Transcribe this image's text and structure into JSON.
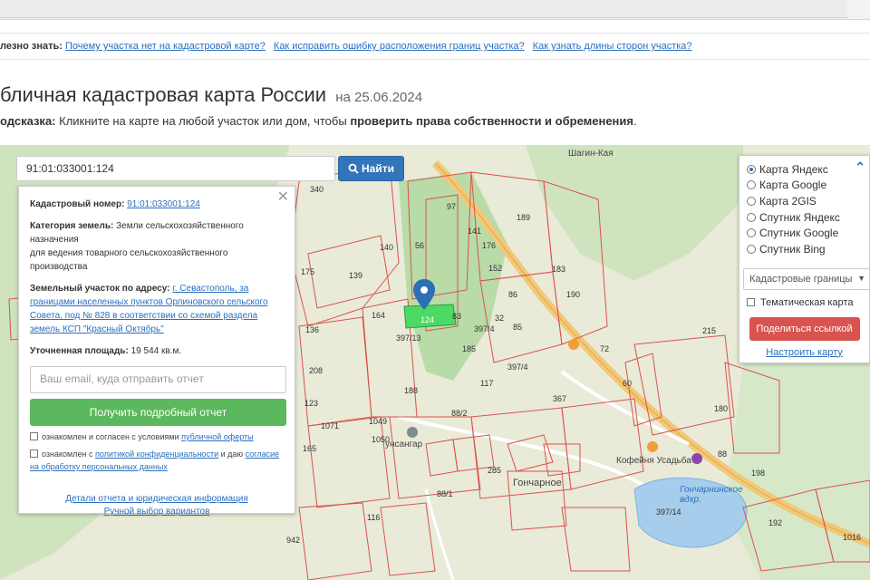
{
  "helpline": {
    "label": "лезно знать:",
    "links": [
      "Почему участка нет на кадастровой карте?",
      "Как исправить ошибку расположения границ участка?",
      "Как узнать длины сторон участка?"
    ]
  },
  "page": {
    "title": "бличная кадастровая карта России",
    "date": "на 25.06.2024",
    "hint_prefix": "одсказка:",
    "hint_text": "Кликните на карте на любой участок или дом, чтобы",
    "hint_bold": "проверить права собственности и обременения",
    "hint_end": "."
  },
  "search": {
    "value": "91:01:033001:124",
    "button_label": "Найти"
  },
  "info": {
    "cadastral_label": "Кадастровый номер:",
    "cadastral_value": "91:01:033001:124",
    "category_label": "Категория земель:",
    "category_value": "Земли сельскохозяйственного назначения",
    "category_use": "для ведения товарного сельскохозяйственного производства",
    "address_label": "Земельный участок по адресу:",
    "address_value": "г. Севастополь, за границами населенных пунктов Орлиновского сельского Совета, под № 828 в соответствии со схемой раздела земель КСП \"Красный Октябрь\"",
    "area_label": "Уточненная площадь:",
    "area_value": "19 544 кв.м.",
    "email_placeholder": "Ваш email, куда отправить отчет",
    "report_button": "Получить подробный отчет",
    "consent1_prefix": "ознакомлен и согласен с условиями",
    "consent1_link": "публичной оферты",
    "consent2_prefix": "ознакомлен с",
    "consent2_link": "политикой конфиденциальности",
    "consent2_mid": "и даю",
    "consent2_link2": "согласие на обработку персональных данных",
    "details_link": "Детали отчета и юридическая информация",
    "manual_link": "Ручной выбор вариантов"
  },
  "layers": {
    "options": [
      "Карта Яндекс",
      "Карта Google",
      "Карта 2GIS",
      "Спутник Яндекс",
      "Спутник Google",
      "Спутник Bing"
    ],
    "selected": "Карта Яндекс",
    "select_value": "Кадастровые границы",
    "thematic_label": "Тематическая карта",
    "share_button": "Поделиться ссылкой",
    "setup_link": "Настроить карту"
  },
  "map": {
    "selected_parcel": "124",
    "parcel_numbers": [
      "97",
      "189",
      "141",
      "176",
      "183",
      "152",
      "86",
      "190",
      "85",
      "32",
      "56",
      "83",
      "139",
      "140",
      "175",
      "136",
      "164",
      "397/13",
      "185",
      "397/4",
      "117",
      "208",
      "188",
      "123",
      "1049",
      "1071",
      "1050",
      "165",
      "88/2",
      "215",
      "180",
      "88",
      "198",
      "192",
      "116",
      "942",
      "285",
      "88/1",
      "397/14",
      "1016",
      "340",
      "60",
      "367",
      "397/4",
      "72"
    ],
    "places": [
      "Шагин-Кая",
      "Гончарное",
      "Гончарнинское вдхр.",
      "Кофейня Усадьба",
      "унсангар"
    ],
    "colors": {
      "background": "#e9ead7",
      "green": "#a9d39c",
      "parcel_line": "#d9534f",
      "road": "#f2c879",
      "water": "#a6cdec",
      "selected": "#4cd964"
    }
  }
}
